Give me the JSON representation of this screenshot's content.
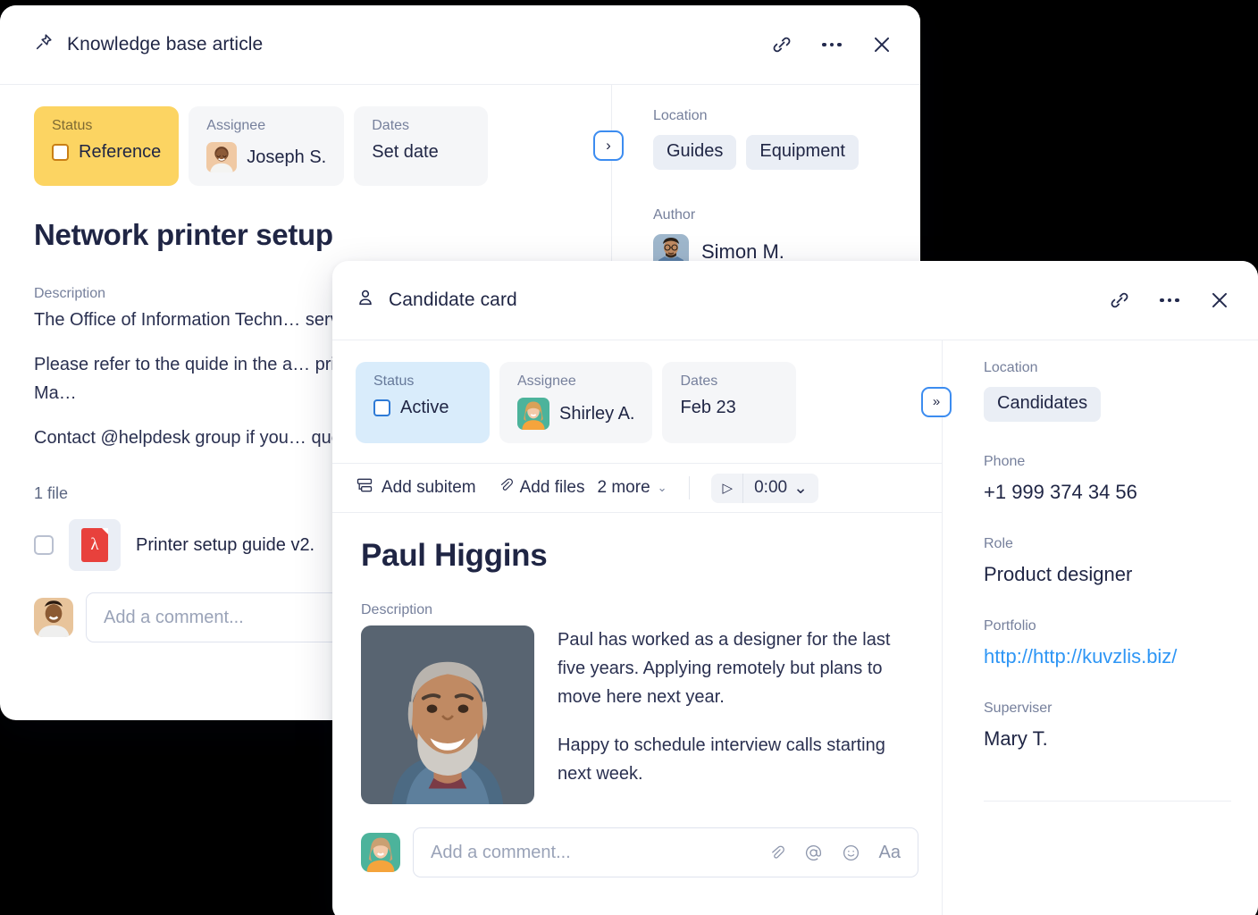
{
  "cards": {
    "knowledge_base": {
      "header": {
        "title": "Knowledge base article",
        "icon": "pin-icon"
      },
      "actions": {
        "link": "link-icon",
        "more": "more-icon",
        "close": "close-icon"
      },
      "fields": [
        {
          "label": "Status",
          "value": "Reference",
          "style": "yellow",
          "has_checkbox": true
        },
        {
          "label": "Assignee",
          "value": "Joseph S.",
          "style": "grey",
          "has_avatar": true
        },
        {
          "label": "Dates",
          "value": "Set date",
          "style": "grey"
        }
      ],
      "expander_label": "›",
      "item_title": "Network printer setup",
      "description_label": "Description",
      "description_paragraphs": [
        "The Office of Information Techn… server for all the networked prin…",
        "Please refer to the quide in the a… printer for both Windows and Ma…",
        "Contact @helpdesk group if you… questions"
      ],
      "files_count_label": "1 file",
      "file": {
        "name": "Printer setup guide v2.",
        "type": "pdf"
      },
      "comment_placeholder": "Add a comment...",
      "side": {
        "location_label": "Location",
        "location_tags": [
          "Guides",
          "Equipment"
        ],
        "author_label": "Author",
        "author_name": "Simon M."
      }
    },
    "candidate": {
      "header": {
        "title": "Candidate card",
        "icon": "person-icon"
      },
      "actions": {
        "link": "link-icon",
        "more": "more-icon",
        "close": "close-icon"
      },
      "fields": [
        {
          "label": "Status",
          "value": "Active",
          "style": "blue",
          "has_checkbox": true
        },
        {
          "label": "Assignee",
          "value": "Shirley A.",
          "style": "grey",
          "has_avatar": true
        },
        {
          "label": "Dates",
          "value": "Feb 23",
          "style": "grey"
        }
      ],
      "expander_label": "»",
      "actions_strip": {
        "add_subitem": "Add subitem",
        "add_files": "Add files",
        "more": "2 more",
        "more_caret": "⌄",
        "play": "▷",
        "timer": "0:00",
        "timer_caret": "⌄"
      },
      "item_title": "Paul Higgins",
      "description_label": "Description",
      "description_paragraphs": [
        "Paul has worked as a designer for the last five years. Applying remotely but plans to move here next year.",
        "Happy to schedule interview calls starting next week."
      ],
      "comment_placeholder": "Add a comment...",
      "comment_tools": [
        "attach-icon",
        "mention-icon",
        "emoji-icon",
        "format-icon"
      ],
      "comment_tool_glyphs": [
        "📎",
        "@",
        "☺",
        "Aa"
      ],
      "side": {
        "location_label": "Location",
        "location_tags": [
          "Candidates"
        ],
        "phone_label": "Phone",
        "phone_value": "+1 999 374 34 56",
        "role_label": "Role",
        "role_value": "Product designer",
        "portfolio_label": "Portfolio",
        "portfolio_value": "http://http://kuvzlis.biz/",
        "supervisor_label": "Superviser",
        "supervisor_value": "Mary T."
      }
    }
  },
  "colors": {
    "status_yellow": "#fcd462",
    "status_blue": "#d9ecfb",
    "link_blue": "#2e96f5",
    "accent_border_blue": "#3c8cf0",
    "text_dark": "#1f2544",
    "text_muted": "#76809c"
  }
}
